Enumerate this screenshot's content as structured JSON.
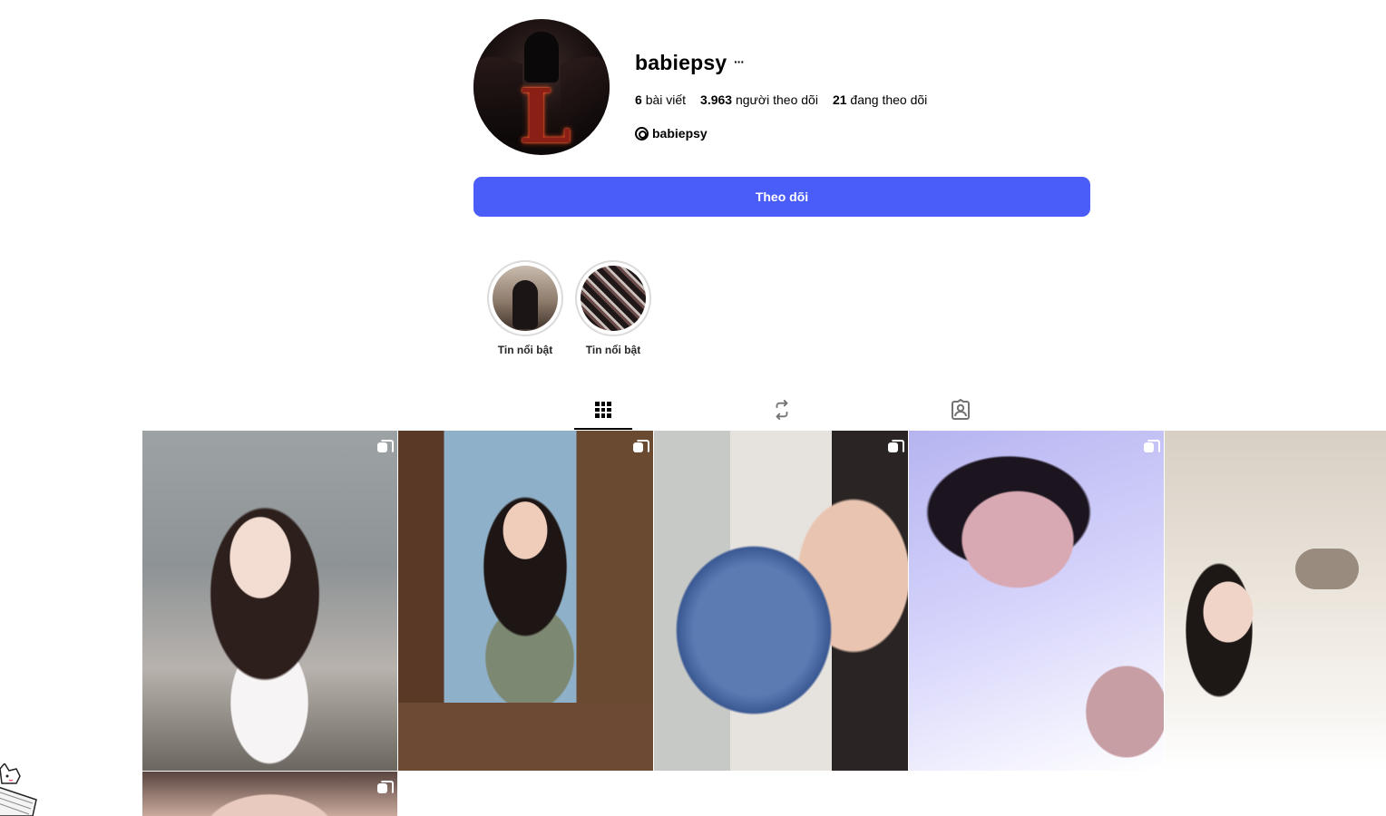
{
  "profile": {
    "username": "babiepsy",
    "more_label": "···",
    "avatar_letter": "L",
    "stats": {
      "posts_count": "6",
      "posts_label": "bài viết",
      "followers_count": "3.963",
      "followers_label": "người theo dõi",
      "following_count": "21",
      "following_label": "đang theo dõi"
    },
    "threads_handle": "babiepsy"
  },
  "follow_button_label": "Theo dõi",
  "highlights": [
    {
      "label": "Tin nổi bật"
    },
    {
      "label": "Tin nổi bật"
    }
  ],
  "tabs": [
    {
      "icon": "grid-icon",
      "active": true
    },
    {
      "icon": "repost-icon",
      "active": false
    },
    {
      "icon": "tagged-icon",
      "active": false
    }
  ],
  "posts": [
    {
      "icon": "multiple-images-icon"
    },
    {
      "icon": "multiple-images-icon"
    },
    {
      "icon": "multiple-images-icon"
    },
    {
      "icon": "multiple-images-icon"
    },
    {
      "icon": null
    },
    {
      "icon": "multiple-images-icon"
    }
  ],
  "colors": {
    "follow_button": "#4a5df9",
    "highlight_ring": "#dbdbdb"
  }
}
